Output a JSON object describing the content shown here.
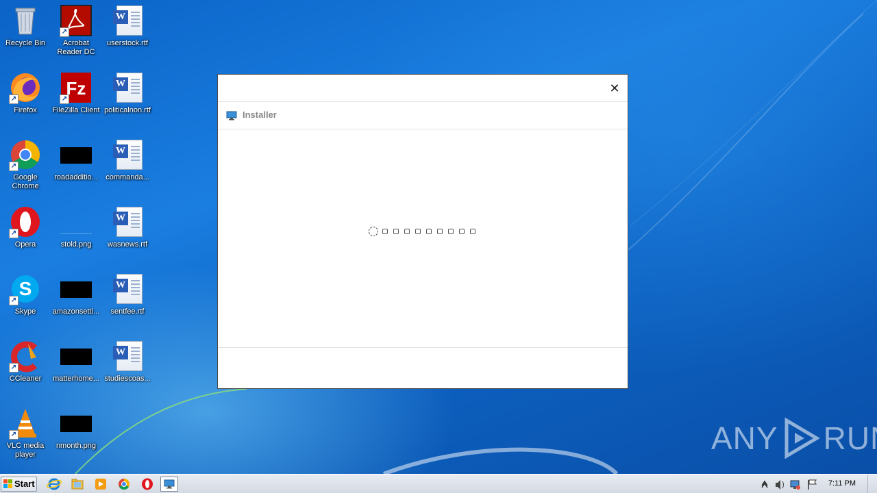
{
  "desktop": {
    "icons": [
      {
        "label": "Recycle Bin"
      },
      {
        "label": "Acrobat Reader DC"
      },
      {
        "label": "userstock.rtf"
      },
      {
        "label": "Firefox"
      },
      {
        "label": "FileZilla Client"
      },
      {
        "label": "politicalnon.rtf"
      },
      {
        "label": "Google Chrome"
      },
      {
        "label": "roadadditio..."
      },
      {
        "label": "commanda..."
      },
      {
        "label": "Opera"
      },
      {
        "label": "stold.png"
      },
      {
        "label": "wasnews.rtf"
      },
      {
        "label": "Skype"
      },
      {
        "label": "amazonsetti..."
      },
      {
        "label": "sentfee.rtf"
      },
      {
        "label": "CCleaner"
      },
      {
        "label": "matterhome..."
      },
      {
        "label": "studiescoas..."
      },
      {
        "label": "VLC media player"
      },
      {
        "label": "nmonth.png"
      }
    ]
  },
  "window": {
    "close_glyph": "✕",
    "header_title": "Installer"
  },
  "watermark": {
    "left": "ANY",
    "right": "RUN"
  },
  "taskbar": {
    "start_label": "Start",
    "clock": "7:11 PM"
  },
  "colors": {
    "desktop": "#0b63c7",
    "taskbar": "#dde3ea"
  }
}
